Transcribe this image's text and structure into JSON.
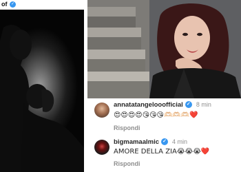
{
  "left_panel": {
    "header_text": "of",
    "verified_glyph": "✓"
  },
  "comments": [
    {
      "username": "annatatangelo official",
      "username_display": "annatatangelooofficial",
      "verified_glyph": "✓",
      "time": "8 min",
      "text": "😍😍😍😍😘😘😘🫶🏻🫶🏻🫶🏻❤️",
      "reply_label": "Rispondi"
    },
    {
      "username": "bigmamaalmic",
      "username_display": "bigmamaalmic",
      "verified_glyph": "✓",
      "time": "4 min",
      "text": "AMORE DELLA ZIA😭😭😭❤️",
      "reply_label": "Rispondi"
    }
  ],
  "colors": {
    "verified": "#3897f0",
    "username": "#262626",
    "muted": "#8e8e8e"
  }
}
